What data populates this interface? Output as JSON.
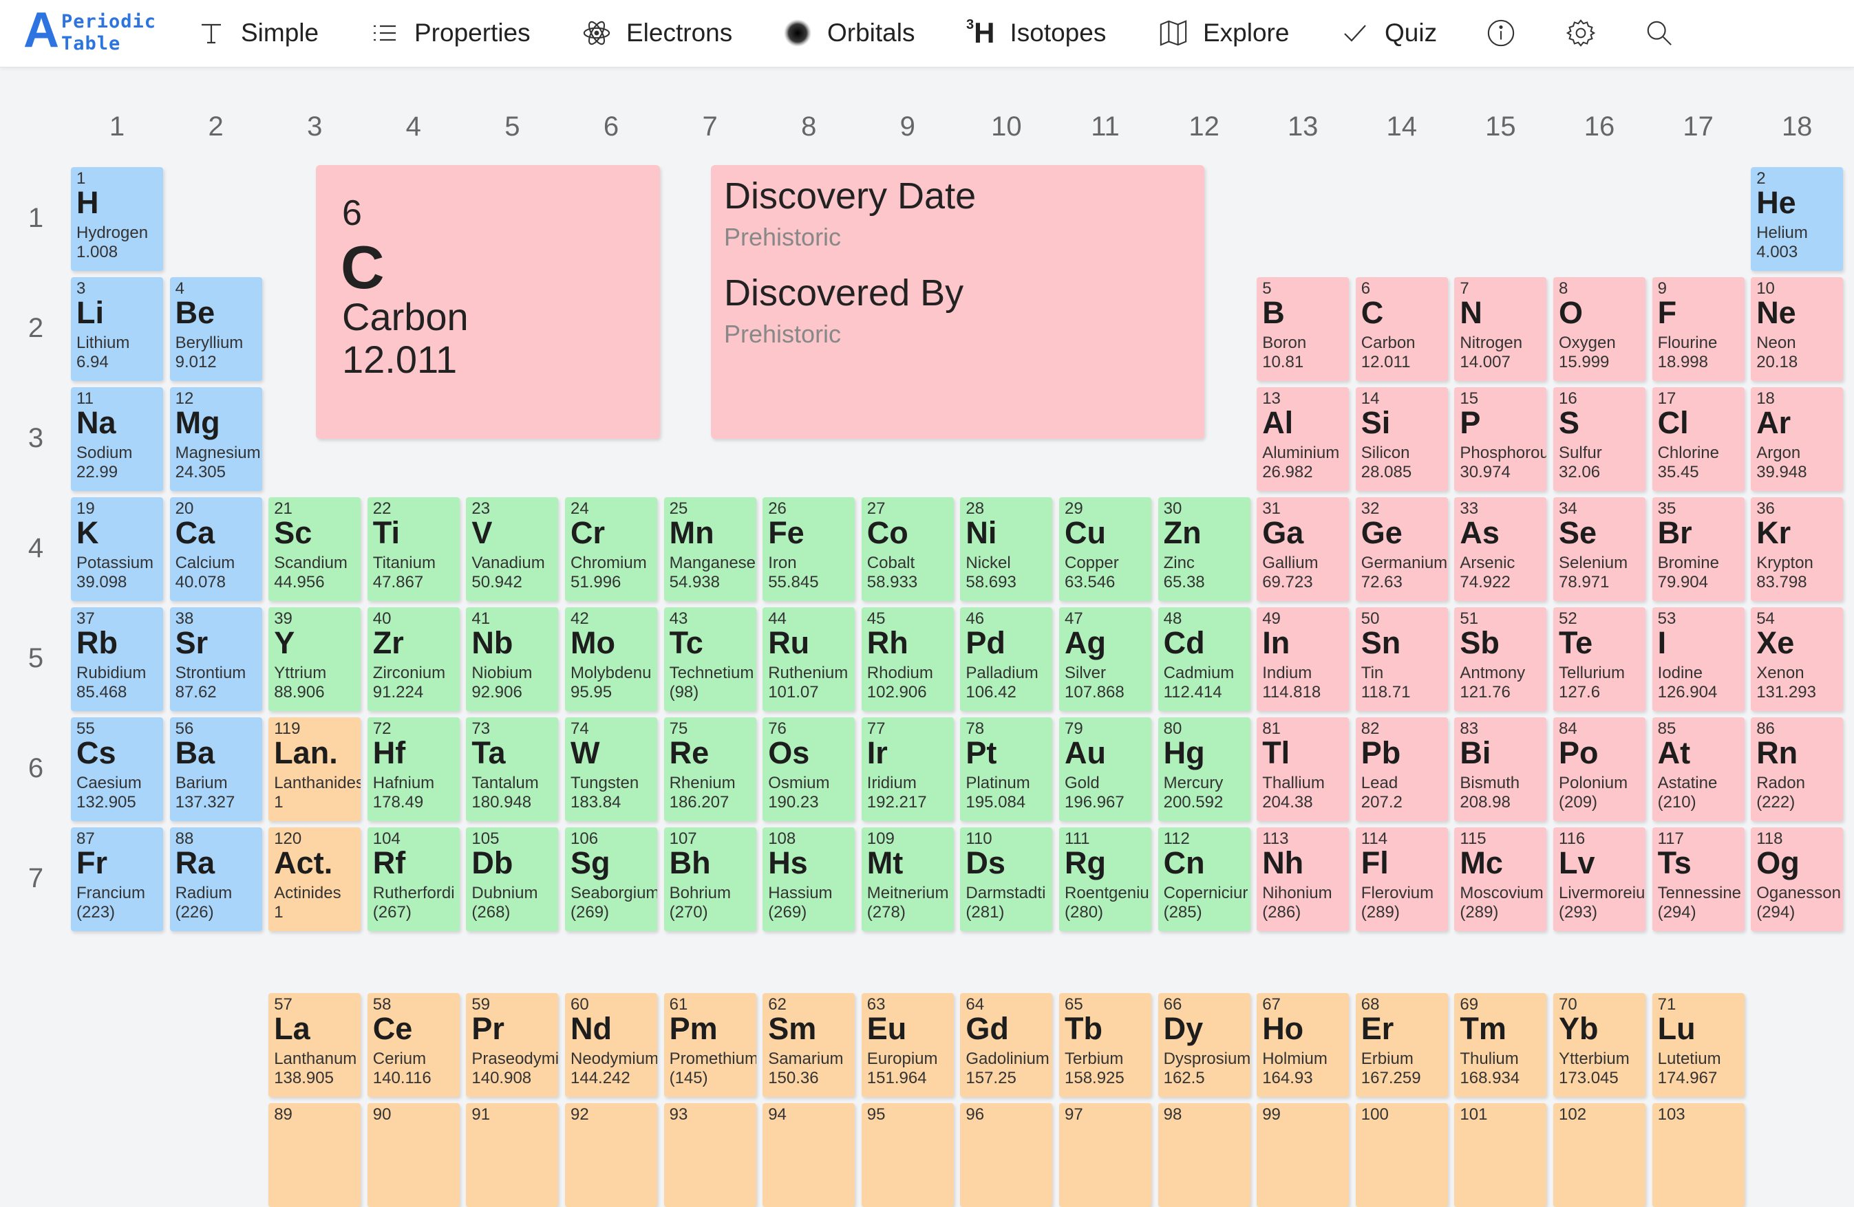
{
  "app": {
    "logo_letter": "A",
    "logo_line1": "Periodic",
    "logo_line2": "Table",
    "brand_color": "#2d74e0"
  },
  "nav": [
    {
      "label": "Simple",
      "icon": "text-t-icon"
    },
    {
      "label": "Properties",
      "icon": "list-icon"
    },
    {
      "label": "Electrons",
      "icon": "atom-icon"
    },
    {
      "label": "Orbitals",
      "icon": "orbital-blob-icon"
    },
    {
      "label": "Isotopes",
      "icon": "isotope-icon",
      "sup": "3",
      "sym": "H"
    },
    {
      "label": "Explore",
      "icon": "map-icon"
    },
    {
      "label": "Quiz",
      "icon": "check-icon"
    }
  ],
  "nav_icons": [
    "info-icon",
    "gear-icon",
    "search-icon"
  ],
  "colors": {
    "alkali": "#a9d5fb",
    "transition": "#b0f0bb",
    "post": "#fcc6ca",
    "lanthanide": "#fdd4a3"
  },
  "group_numbers": [
    "1",
    "2",
    "3",
    "4",
    "5",
    "6",
    "7",
    "8",
    "9",
    "10",
    "11",
    "12",
    "13",
    "14",
    "15",
    "16",
    "17",
    "18"
  ],
  "period_numbers": [
    "1",
    "2",
    "3",
    "4",
    "5",
    "6",
    "7"
  ],
  "selected": {
    "number": "6",
    "symbol": "C",
    "name": "Carbon",
    "weight": "12.011"
  },
  "discovery": {
    "date_label": "Discovery Date",
    "date_value": "Prehistoric",
    "by_label": "Discovered By",
    "by_value": "Prehistoric"
  },
  "elements": [
    {
      "n": "1",
      "s": "H",
      "name": "Hydrogen",
      "w": "1.008",
      "g": 1,
      "p": 1,
      "c": "alkali"
    },
    {
      "n": "2",
      "s": "He",
      "name": "Helium",
      "w": "4.003",
      "g": 18,
      "p": 1,
      "c": "alkali"
    },
    {
      "n": "3",
      "s": "Li",
      "name": "Lithium",
      "w": "6.94",
      "g": 1,
      "p": 2,
      "c": "alkali"
    },
    {
      "n": "4",
      "s": "Be",
      "name": "Beryllium",
      "w": "9.012",
      "g": 2,
      "p": 2,
      "c": "alkali"
    },
    {
      "n": "5",
      "s": "B",
      "name": "Boron",
      "w": "10.81",
      "g": 13,
      "p": 2,
      "c": "post"
    },
    {
      "n": "6",
      "s": "C",
      "name": "Carbon",
      "w": "12.011",
      "g": 14,
      "p": 2,
      "c": "post"
    },
    {
      "n": "7",
      "s": "N",
      "name": "Nitrogen",
      "w": "14.007",
      "g": 15,
      "p": 2,
      "c": "post"
    },
    {
      "n": "8",
      "s": "O",
      "name": "Oxygen",
      "w": "15.999",
      "g": 16,
      "p": 2,
      "c": "post"
    },
    {
      "n": "9",
      "s": "F",
      "name": "Flourine",
      "w": "18.998",
      "g": 17,
      "p": 2,
      "c": "post"
    },
    {
      "n": "10",
      "s": "Ne",
      "name": "Neon",
      "w": "20.18",
      "g": 18,
      "p": 2,
      "c": "post"
    },
    {
      "n": "11",
      "s": "Na",
      "name": "Sodium",
      "w": "22.99",
      "g": 1,
      "p": 3,
      "c": "alkali"
    },
    {
      "n": "12",
      "s": "Mg",
      "name": "Magnesium",
      "w": "24.305",
      "g": 2,
      "p": 3,
      "c": "alkali"
    },
    {
      "n": "13",
      "s": "Al",
      "name": "Aluminium",
      "w": "26.982",
      "g": 13,
      "p": 3,
      "c": "post"
    },
    {
      "n": "14",
      "s": "Si",
      "name": "Silicon",
      "w": "28.085",
      "g": 14,
      "p": 3,
      "c": "post"
    },
    {
      "n": "15",
      "s": "P",
      "name": "Phosphorou",
      "w": "30.974",
      "g": 15,
      "p": 3,
      "c": "post"
    },
    {
      "n": "16",
      "s": "S",
      "name": "Sulfur",
      "w": "32.06",
      "g": 16,
      "p": 3,
      "c": "post"
    },
    {
      "n": "17",
      "s": "Cl",
      "name": "Chlorine",
      "w": "35.45",
      "g": 17,
      "p": 3,
      "c": "post"
    },
    {
      "n": "18",
      "s": "Ar",
      "name": "Argon",
      "w": "39.948",
      "g": 18,
      "p": 3,
      "c": "post"
    },
    {
      "n": "19",
      "s": "K",
      "name": "Potassium",
      "w": "39.098",
      "g": 1,
      "p": 4,
      "c": "alkali"
    },
    {
      "n": "20",
      "s": "Ca",
      "name": "Calcium",
      "w": "40.078",
      "g": 2,
      "p": 4,
      "c": "alkali"
    },
    {
      "n": "21",
      "s": "Sc",
      "name": "Scandium",
      "w": "44.956",
      "g": 3,
      "p": 4,
      "c": "trans"
    },
    {
      "n": "22",
      "s": "Ti",
      "name": "Titanium",
      "w": "47.867",
      "g": 4,
      "p": 4,
      "c": "trans"
    },
    {
      "n": "23",
      "s": "V",
      "name": "Vanadium",
      "w": "50.942",
      "g": 5,
      "p": 4,
      "c": "trans"
    },
    {
      "n": "24",
      "s": "Cr",
      "name": "Chromium",
      "w": "51.996",
      "g": 6,
      "p": 4,
      "c": "trans"
    },
    {
      "n": "25",
      "s": "Mn",
      "name": "Manganese",
      "w": "54.938",
      "g": 7,
      "p": 4,
      "c": "trans"
    },
    {
      "n": "26",
      "s": "Fe",
      "name": "Iron",
      "w": "55.845",
      "g": 8,
      "p": 4,
      "c": "trans"
    },
    {
      "n": "27",
      "s": "Co",
      "name": "Cobalt",
      "w": "58.933",
      "g": 9,
      "p": 4,
      "c": "trans"
    },
    {
      "n": "28",
      "s": "Ni",
      "name": "Nickel",
      "w": "58.693",
      "g": 10,
      "p": 4,
      "c": "trans"
    },
    {
      "n": "29",
      "s": "Cu",
      "name": "Copper",
      "w": "63.546",
      "g": 11,
      "p": 4,
      "c": "trans"
    },
    {
      "n": "30",
      "s": "Zn",
      "name": "Zinc",
      "w": "65.38",
      "g": 12,
      "p": 4,
      "c": "trans"
    },
    {
      "n": "31",
      "s": "Ga",
      "name": "Gallium",
      "w": "69.723",
      "g": 13,
      "p": 4,
      "c": "post"
    },
    {
      "n": "32",
      "s": "Ge",
      "name": "Germanium",
      "w": "72.63",
      "g": 14,
      "p": 4,
      "c": "post"
    },
    {
      "n": "33",
      "s": "As",
      "name": "Arsenic",
      "w": "74.922",
      "g": 15,
      "p": 4,
      "c": "post"
    },
    {
      "n": "34",
      "s": "Se",
      "name": "Selenium",
      "w": "78.971",
      "g": 16,
      "p": 4,
      "c": "post"
    },
    {
      "n": "35",
      "s": "Br",
      "name": "Bromine",
      "w": "79.904",
      "g": 17,
      "p": 4,
      "c": "post"
    },
    {
      "n": "36",
      "s": "Kr",
      "name": "Krypton",
      "w": "83.798",
      "g": 18,
      "p": 4,
      "c": "post"
    },
    {
      "n": "37",
      "s": "Rb",
      "name": "Rubidium",
      "w": "85.468",
      "g": 1,
      "p": 5,
      "c": "alkali"
    },
    {
      "n": "38",
      "s": "Sr",
      "name": "Strontium",
      "w": "87.62",
      "g": 2,
      "p": 5,
      "c": "alkali"
    },
    {
      "n": "39",
      "s": "Y",
      "name": "Yttrium",
      "w": "88.906",
      "g": 3,
      "p": 5,
      "c": "trans"
    },
    {
      "n": "40",
      "s": "Zr",
      "name": "Zirconium",
      "w": "91.224",
      "g": 4,
      "p": 5,
      "c": "trans"
    },
    {
      "n": "41",
      "s": "Nb",
      "name": "Niobium",
      "w": "92.906",
      "g": 5,
      "p": 5,
      "c": "trans"
    },
    {
      "n": "42",
      "s": "Mo",
      "name": "Molybdenu",
      "w": "95.95",
      "g": 6,
      "p": 5,
      "c": "trans"
    },
    {
      "n": "43",
      "s": "Tc",
      "name": "Technetium",
      "w": "(98)",
      "g": 7,
      "p": 5,
      "c": "trans"
    },
    {
      "n": "44",
      "s": "Ru",
      "name": "Ruthenium",
      "w": "101.07",
      "g": 8,
      "p": 5,
      "c": "trans"
    },
    {
      "n": "45",
      "s": "Rh",
      "name": "Rhodium",
      "w": "102.906",
      "g": 9,
      "p": 5,
      "c": "trans"
    },
    {
      "n": "46",
      "s": "Pd",
      "name": "Palladium",
      "w": "106.42",
      "g": 10,
      "p": 5,
      "c": "trans"
    },
    {
      "n": "47",
      "s": "Ag",
      "name": "Silver",
      "w": "107.868",
      "g": 11,
      "p": 5,
      "c": "trans"
    },
    {
      "n": "48",
      "s": "Cd",
      "name": "Cadmium",
      "w": "112.414",
      "g": 12,
      "p": 5,
      "c": "trans"
    },
    {
      "n": "49",
      "s": "In",
      "name": "Indium",
      "w": "114.818",
      "g": 13,
      "p": 5,
      "c": "post"
    },
    {
      "n": "50",
      "s": "Sn",
      "name": "Tin",
      "w": "118.71",
      "g": 14,
      "p": 5,
      "c": "post"
    },
    {
      "n": "51",
      "s": "Sb",
      "name": "Antmony",
      "w": "121.76",
      "g": 15,
      "p": 5,
      "c": "post"
    },
    {
      "n": "52",
      "s": "Te",
      "name": "Tellurium",
      "w": "127.6",
      "g": 16,
      "p": 5,
      "c": "post"
    },
    {
      "n": "53",
      "s": "I",
      "name": "Iodine",
      "w": "126.904",
      "g": 17,
      "p": 5,
      "c": "post"
    },
    {
      "n": "54",
      "s": "Xe",
      "name": "Xenon",
      "w": "131.293",
      "g": 18,
      "p": 5,
      "c": "post"
    },
    {
      "n": "55",
      "s": "Cs",
      "name": "Caesium",
      "w": "132.905",
      "g": 1,
      "p": 6,
      "c": "alkali"
    },
    {
      "n": "56",
      "s": "Ba",
      "name": "Barium",
      "w": "137.327",
      "g": 2,
      "p": 6,
      "c": "alkali"
    },
    {
      "n": "119",
      "s": "Lan.",
      "name": "Lanthanides",
      "w": "1",
      "g": 3,
      "p": 6,
      "c": "lan"
    },
    {
      "n": "72",
      "s": "Hf",
      "name": "Hafnium",
      "w": "178.49",
      "g": 4,
      "p": 6,
      "c": "trans"
    },
    {
      "n": "73",
      "s": "Ta",
      "name": "Tantalum",
      "w": "180.948",
      "g": 5,
      "p": 6,
      "c": "trans"
    },
    {
      "n": "74",
      "s": "W",
      "name": "Tungsten",
      "w": "183.84",
      "g": 6,
      "p": 6,
      "c": "trans"
    },
    {
      "n": "75",
      "s": "Re",
      "name": "Rhenium",
      "w": "186.207",
      "g": 7,
      "p": 6,
      "c": "trans"
    },
    {
      "n": "76",
      "s": "Os",
      "name": "Osmium",
      "w": "190.23",
      "g": 8,
      "p": 6,
      "c": "trans"
    },
    {
      "n": "77",
      "s": "Ir",
      "name": "Iridium",
      "w": "192.217",
      "g": 9,
      "p": 6,
      "c": "trans"
    },
    {
      "n": "78",
      "s": "Pt",
      "name": "Platinum",
      "w": "195.084",
      "g": 10,
      "p": 6,
      "c": "trans"
    },
    {
      "n": "79",
      "s": "Au",
      "name": "Gold",
      "w": "196.967",
      "g": 11,
      "p": 6,
      "c": "trans"
    },
    {
      "n": "80",
      "s": "Hg",
      "name": "Mercury",
      "w": "200.592",
      "g": 12,
      "p": 6,
      "c": "trans"
    },
    {
      "n": "81",
      "s": "Tl",
      "name": "Thallium",
      "w": "204.38",
      "g": 13,
      "p": 6,
      "c": "post"
    },
    {
      "n": "82",
      "s": "Pb",
      "name": "Lead",
      "w": "207.2",
      "g": 14,
      "p": 6,
      "c": "post"
    },
    {
      "n": "83",
      "s": "Bi",
      "name": "Bismuth",
      "w": "208.98",
      "g": 15,
      "p": 6,
      "c": "post"
    },
    {
      "n": "84",
      "s": "Po",
      "name": "Polonium",
      "w": "(209)",
      "g": 16,
      "p": 6,
      "c": "post"
    },
    {
      "n": "85",
      "s": "At",
      "name": "Astatine",
      "w": "(210)",
      "g": 17,
      "p": 6,
      "c": "post"
    },
    {
      "n": "86",
      "s": "Rn",
      "name": "Radon",
      "w": "(222)",
      "g": 18,
      "p": 6,
      "c": "post"
    },
    {
      "n": "87",
      "s": "Fr",
      "name": "Francium",
      "w": "(223)",
      "g": 1,
      "p": 7,
      "c": "alkali"
    },
    {
      "n": "88",
      "s": "Ra",
      "name": "Radium",
      "w": "(226)",
      "g": 2,
      "p": 7,
      "c": "alkali"
    },
    {
      "n": "120",
      "s": "Act.",
      "name": "Actinides",
      "w": "1",
      "g": 3,
      "p": 7,
      "c": "lan"
    },
    {
      "n": "104",
      "s": "Rf",
      "name": "Rutherfordi",
      "w": "(267)",
      "g": 4,
      "p": 7,
      "c": "trans"
    },
    {
      "n": "105",
      "s": "Db",
      "name": "Dubnium",
      "w": "(268)",
      "g": 5,
      "p": 7,
      "c": "trans"
    },
    {
      "n": "106",
      "s": "Sg",
      "name": "Seaborgium",
      "w": "(269)",
      "g": 6,
      "p": 7,
      "c": "trans"
    },
    {
      "n": "107",
      "s": "Bh",
      "name": "Bohrium",
      "w": "(270)",
      "g": 7,
      "p": 7,
      "c": "trans"
    },
    {
      "n": "108",
      "s": "Hs",
      "name": "Hassium",
      "w": "(269)",
      "g": 8,
      "p": 7,
      "c": "trans"
    },
    {
      "n": "109",
      "s": "Mt",
      "name": "Meitnerium",
      "w": "(278)",
      "g": 9,
      "p": 7,
      "c": "trans"
    },
    {
      "n": "110",
      "s": "Ds",
      "name": "Darmstadti",
      "w": "(281)",
      "g": 10,
      "p": 7,
      "c": "trans"
    },
    {
      "n": "111",
      "s": "Rg",
      "name": "Roentgeniu",
      "w": "(280)",
      "g": 11,
      "p": 7,
      "c": "trans"
    },
    {
      "n": "112",
      "s": "Cn",
      "name": "Coperniciur",
      "w": "(285)",
      "g": 12,
      "p": 7,
      "c": "trans"
    },
    {
      "n": "113",
      "s": "Nh",
      "name": "Nihonium",
      "w": "(286)",
      "g": 13,
      "p": 7,
      "c": "post"
    },
    {
      "n": "114",
      "s": "Fl",
      "name": "Flerovium",
      "w": "(289)",
      "g": 14,
      "p": 7,
      "c": "post"
    },
    {
      "n": "115",
      "s": "Mc",
      "name": "Moscovium",
      "w": "(289)",
      "g": 15,
      "p": 7,
      "c": "post"
    },
    {
      "n": "116",
      "s": "Lv",
      "name": "Livermoreiu",
      "w": "(293)",
      "g": 16,
      "p": 7,
      "c": "post"
    },
    {
      "n": "117",
      "s": "Ts",
      "name": "Tennessine",
      "w": "(294)",
      "g": 17,
      "p": 7,
      "c": "post"
    },
    {
      "n": "118",
      "s": "Og",
      "name": "Oganesson",
      "w": "(294)",
      "g": 18,
      "p": 7,
      "c": "post"
    }
  ],
  "lanthanides": [
    {
      "n": "57",
      "s": "La",
      "name": "Lanthanum",
      "w": "138.905"
    },
    {
      "n": "58",
      "s": "Ce",
      "name": "Cerium",
      "w": "140.116"
    },
    {
      "n": "59",
      "s": "Pr",
      "name": "Praseodymi",
      "w": "140.908"
    },
    {
      "n": "60",
      "s": "Nd",
      "name": "Neodymium",
      "w": "144.242"
    },
    {
      "n": "61",
      "s": "Pm",
      "name": "Promethium",
      "w": "(145)"
    },
    {
      "n": "62",
      "s": "Sm",
      "name": "Samarium",
      "w": "150.36"
    },
    {
      "n": "63",
      "s": "Eu",
      "name": "Europium",
      "w": "151.964"
    },
    {
      "n": "64",
      "s": "Gd",
      "name": "Gadolinium",
      "w": "157.25"
    },
    {
      "n": "65",
      "s": "Tb",
      "name": "Terbium",
      "w": "158.925"
    },
    {
      "n": "66",
      "s": "Dy",
      "name": "Dysprosium",
      "w": "162.5"
    },
    {
      "n": "67",
      "s": "Ho",
      "name": "Holmium",
      "w": "164.93"
    },
    {
      "n": "68",
      "s": "Er",
      "name": "Erbium",
      "w": "167.259"
    },
    {
      "n": "69",
      "s": "Tm",
      "name": "Thulium",
      "w": "168.934"
    },
    {
      "n": "70",
      "s": "Yb",
      "name": "Ytterbium",
      "w": "173.045"
    },
    {
      "n": "71",
      "s": "Lu",
      "name": "Lutetium",
      "w": "174.967"
    }
  ],
  "actinide_numbers": [
    "89",
    "90",
    "91",
    "92",
    "93",
    "94",
    "95",
    "96",
    "97",
    "98",
    "99",
    "100",
    "101",
    "102",
    "103"
  ]
}
